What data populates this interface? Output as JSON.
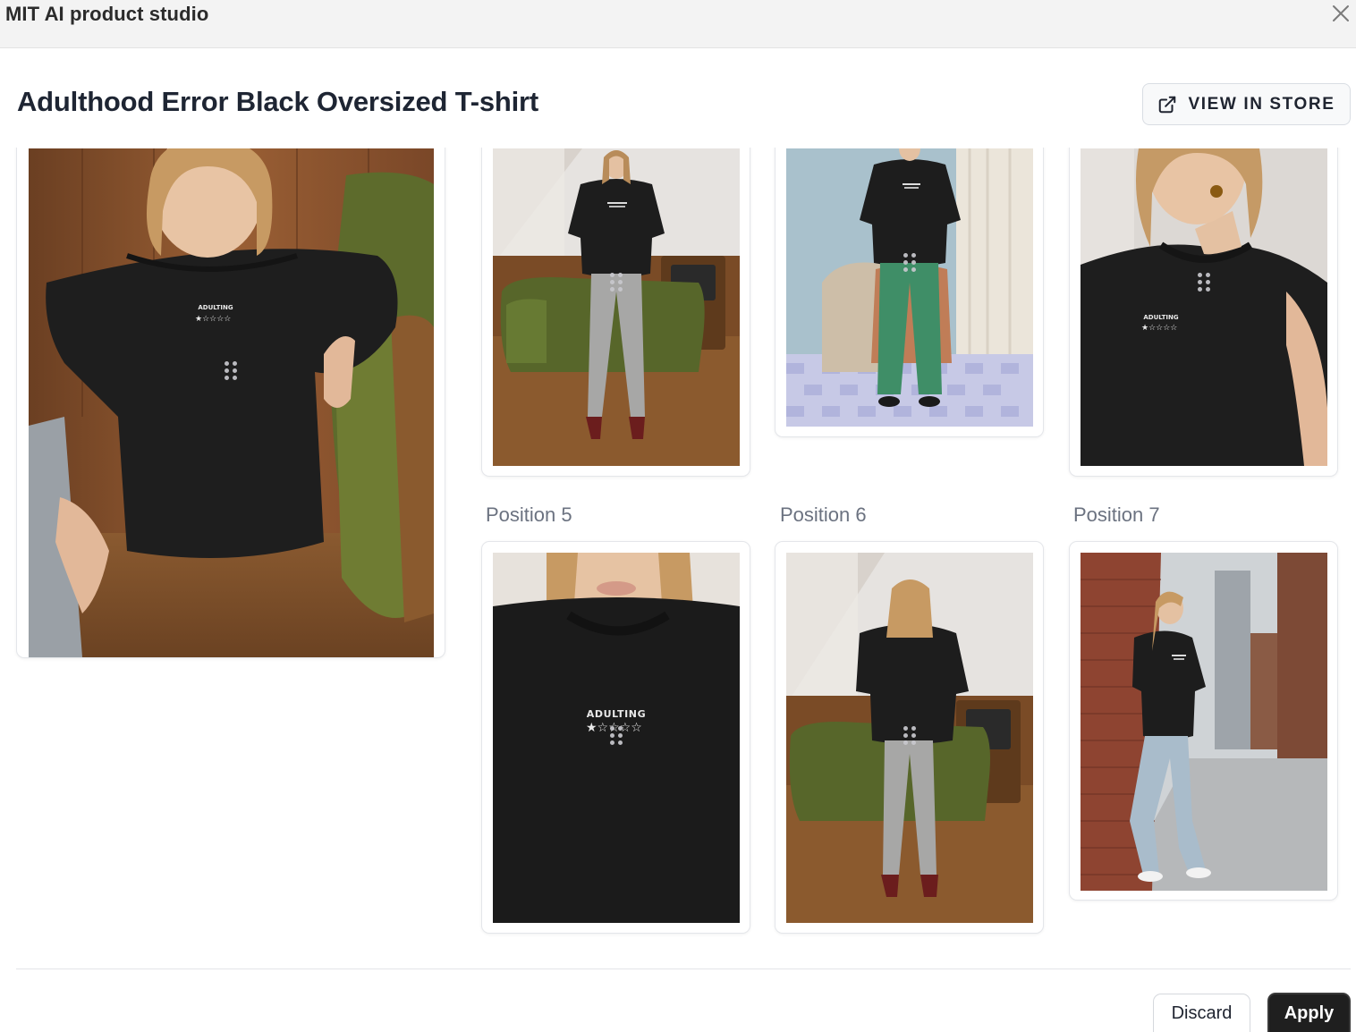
{
  "app": {
    "title": "MIT AI product studio"
  },
  "header": {
    "product_title": "Adulthood Error Black Oversized T-shirt",
    "view_store_label": "VIEW IN STORE"
  },
  "gallery": {
    "positions": [
      {
        "label": "",
        "image": "woman-sitting-by-green-sofa"
      },
      {
        "label": "",
        "image": "full-body-front-green-sofa-room"
      },
      {
        "label": "",
        "image": "full-body-front-green-pants"
      },
      {
        "label": "",
        "image": "upper-body-closeup"
      },
      {
        "label": "Position 5",
        "image": "chest-print-closeup"
      },
      {
        "label": "Position 6",
        "image": "back-view-green-sofa-room"
      },
      {
        "label": "Position 7",
        "image": "leaning-on-brick-wall-street"
      }
    ],
    "print_text": "ADULTING"
  },
  "footer": {
    "discard_label": "Discard",
    "apply_label": "Apply"
  },
  "colors": {
    "shirt": "#1c1c1c",
    "accent_dark": "#1f1f1f",
    "border": "#e4e6ea"
  }
}
